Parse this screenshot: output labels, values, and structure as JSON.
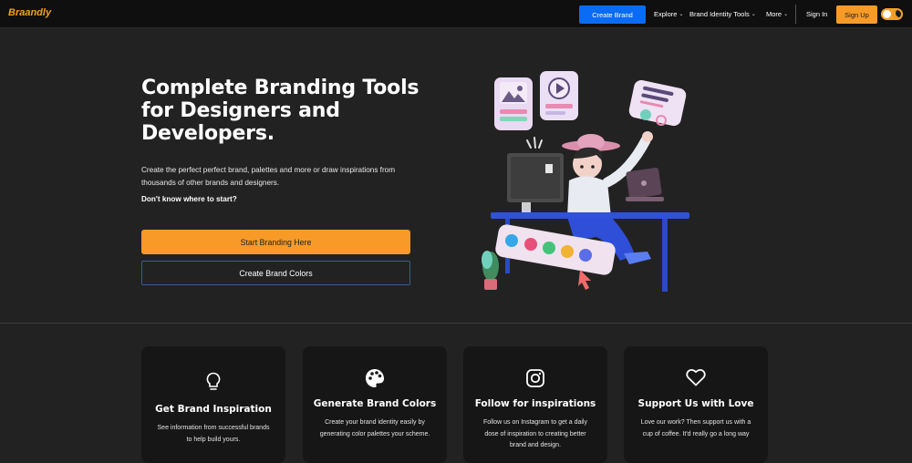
{
  "nav": {
    "logo": "Braandly",
    "create_brand": "Create Brand",
    "explore": "Explore",
    "brand_identity_tools": "Brand Identity Tools",
    "more": "More",
    "sign_in": "Sign In",
    "sign_up": "Sign Up"
  },
  "hero": {
    "title": "Complete Branding Tools for Designers and Developers.",
    "description": "Create the perfect perfect brand, palettes and more or draw inspirations from thousands of other brands and designers.",
    "question": "Don't know where to start?",
    "primary_button": "Start Branding Here",
    "secondary_button": "Create Brand Colors"
  },
  "features": [
    {
      "icon": "lightbulb-icon",
      "title": "Get Brand Inspiration",
      "text": "See information from successful brands to help build yours."
    },
    {
      "icon": "palette-icon",
      "title": "Generate Brand Colors",
      "text": "Create your brand identity easily by generating color palettes your scheme."
    },
    {
      "icon": "instagram-icon",
      "title": "Follow for inspirations",
      "text": "Follow us on Instagram to get a daily dose of inspiration to creating better brand and design."
    },
    {
      "icon": "heart-icon",
      "title": "Support Us with Love",
      "text": "Love our work? Then support us with a cup of coffee. It'd really go a long way"
    }
  ],
  "colors": {
    "accent_orange": "#f79a28",
    "primary_blue": "#0a6cf5",
    "background": "#222222",
    "card": "#161616"
  }
}
